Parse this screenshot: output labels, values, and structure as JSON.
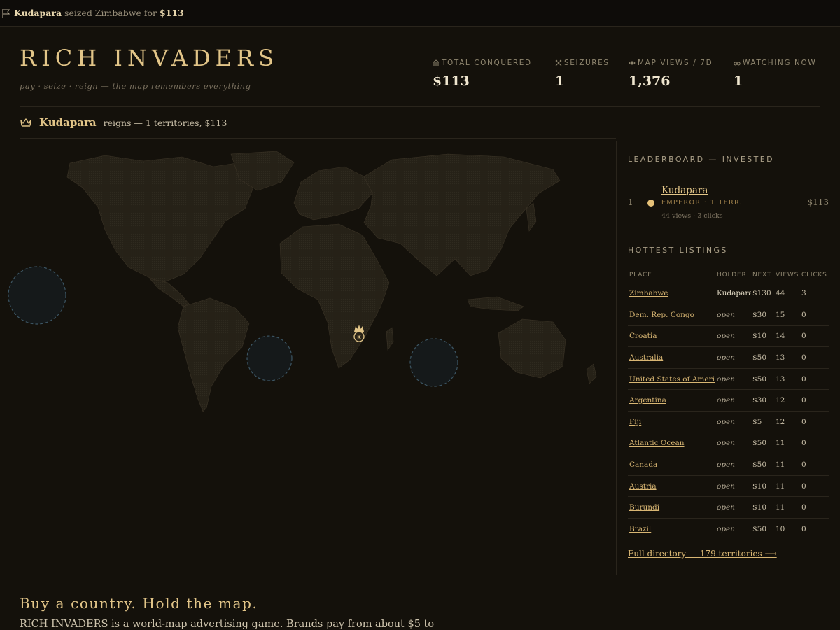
{
  "ticker": {
    "player": "Kudapara",
    "action": "seized Zimbabwe for",
    "amount": "$113"
  },
  "header": {
    "title": "RICH INVADERS",
    "tagline": "pay · seize · reign — the map remembers everything"
  },
  "stats": [
    {
      "label": "TOTAL CONQUERED",
      "value": "$113",
      "icon": "bank-icon"
    },
    {
      "label": "SEIZURES",
      "value": "1",
      "icon": "crossed-swords-icon"
    },
    {
      "label": "MAP VIEWS / 7D",
      "value": "1,376",
      "icon": "eye-icon"
    },
    {
      "label": "WATCHING NOW",
      "value": "1",
      "icon": "binoculars-icon"
    }
  ],
  "reign": {
    "name": "Kudapara",
    "text": "reigns — 1 territories, $113"
  },
  "map": {
    "marker_label": "K"
  },
  "leaderboard": {
    "heading": "LEADERBOARD — INVESTED",
    "entries": [
      {
        "rank": "1",
        "name": "Kudapara",
        "title": "EMPEROR · 1 TERR.",
        "meta": "44 views · 3 clicks",
        "amount": "$113",
        "color": "#e6c178"
      }
    ]
  },
  "listings": {
    "heading": "HOTTEST LISTINGS",
    "columns": [
      "PLACE",
      "HOLDER",
      "NEXT",
      "VIEWS",
      "CLICKS"
    ],
    "rows": [
      {
        "place": "Zimbabwe",
        "holder": "Kudapara",
        "next": "$130",
        "views": "44",
        "clicks": "3"
      },
      {
        "place": "Dem. Rep. Congo",
        "holder": "open",
        "next": "$30",
        "views": "15",
        "clicks": "0"
      },
      {
        "place": "Croatia",
        "holder": "open",
        "next": "$10",
        "views": "14",
        "clicks": "0"
      },
      {
        "place": "Australia",
        "holder": "open",
        "next": "$50",
        "views": "13",
        "clicks": "0"
      },
      {
        "place": "United States of America",
        "holder": "open",
        "next": "$50",
        "views": "13",
        "clicks": "0"
      },
      {
        "place": "Argentina",
        "holder": "open",
        "next": "$30",
        "views": "12",
        "clicks": "0"
      },
      {
        "place": "Fiji",
        "holder": "open",
        "next": "$5",
        "views": "12",
        "clicks": "0"
      },
      {
        "place": "Atlantic Ocean",
        "holder": "open",
        "next": "$50",
        "views": "11",
        "clicks": "0"
      },
      {
        "place": "Canada",
        "holder": "open",
        "next": "$50",
        "views": "11",
        "clicks": "0"
      },
      {
        "place": "Austria",
        "holder": "open",
        "next": "$10",
        "views": "11",
        "clicks": "0"
      },
      {
        "place": "Burundi",
        "holder": "open",
        "next": "$10",
        "views": "11",
        "clicks": "0"
      },
      {
        "place": "Brazil",
        "holder": "open",
        "next": "$50",
        "views": "10",
        "clicks": "0"
      }
    ],
    "directory_link": "Full directory — 179 territories ⟶"
  },
  "pitch": {
    "heading": "Buy a country. Hold the map.",
    "body": "RICH INVADERS is a world-map advertising game. Brands pay from about $5 to"
  },
  "colors": {
    "background": "#14110b",
    "accent": "#e2c588",
    "land": "#2a251b",
    "ocean_zone": "#151a1b"
  }
}
